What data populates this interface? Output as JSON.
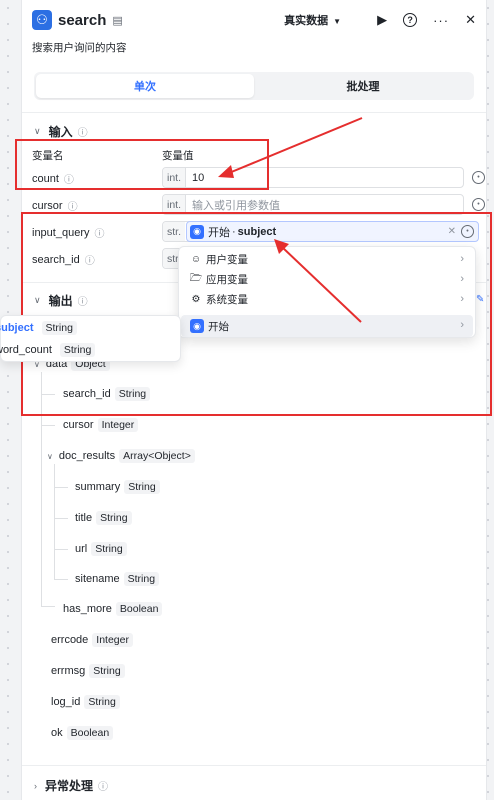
{
  "header": {
    "title": "search",
    "description": "搜索用户询问的内容",
    "mode_label": "真实数据",
    "icons": [
      "node-icon",
      "play-icon",
      "help-icon",
      "more-icon",
      "close-icon"
    ]
  },
  "tabs": [
    {
      "label": "单次",
      "active": true
    },
    {
      "label": "批处理",
      "active": false
    }
  ],
  "input_section": {
    "title": "输入",
    "col_name": "变量名",
    "col_value": "变量值",
    "rows": [
      {
        "name": "count",
        "type": "int.",
        "value": "10",
        "placeholder": ""
      },
      {
        "name": "cursor",
        "type": "int.",
        "value": "",
        "placeholder": "输入或引用参数值"
      },
      {
        "name": "input_query",
        "type": "str.",
        "ref_node": "开始",
        "ref_var": "subject"
      },
      {
        "name": "search_id",
        "type": "str."
      }
    ]
  },
  "dropdown": {
    "items": [
      {
        "label": "用户变量",
        "icon": "user-icon"
      },
      {
        "label": "应用变量",
        "icon": "folder-icon"
      },
      {
        "label": "系统变量",
        "icon": "gear-icon"
      },
      {
        "label": "开始",
        "icon": "start-icon"
      }
    ]
  },
  "tooltip": {
    "items": [
      {
        "name": "subject",
        "type": "String",
        "active": true
      },
      {
        "name": "word_count",
        "type": "String",
        "active": false
      }
    ]
  },
  "output_section": {
    "title": "输出",
    "items": [
      {
        "name": "data",
        "type": "Object"
      },
      {
        "name": "search_id",
        "type": "String"
      },
      {
        "name": "cursor",
        "type": "Integer"
      },
      {
        "name": "doc_results",
        "type": "Array<Object>"
      },
      {
        "name": "summary",
        "type": "String"
      },
      {
        "name": "title",
        "type": "String"
      },
      {
        "name": "url",
        "type": "String"
      },
      {
        "name": "sitename",
        "type": "String"
      },
      {
        "name": "has_more",
        "type": "Boolean"
      },
      {
        "name": "errcode",
        "type": "Integer"
      },
      {
        "name": "errmsg",
        "type": "String"
      },
      {
        "name": "log_id",
        "type": "String"
      },
      {
        "name": "ok",
        "type": "Boolean"
      }
    ]
  },
  "error_section": {
    "title": "异常处理"
  },
  "colors": {
    "accent": "#3370ff",
    "annotation_red": "#e52e2e"
  }
}
